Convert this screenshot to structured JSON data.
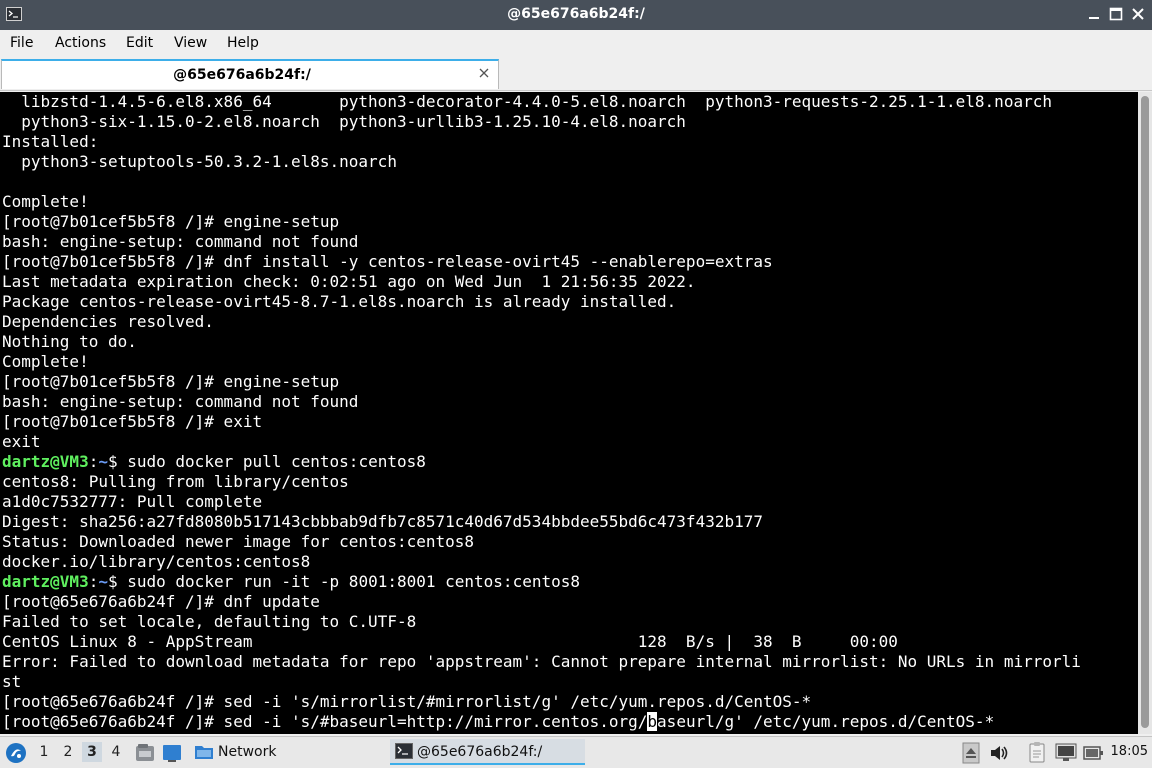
{
  "window": {
    "title": "@65e676a6b24f:/"
  },
  "menubar": {
    "items": [
      "File",
      "Actions",
      "Edit",
      "View",
      "Help"
    ]
  },
  "tab": {
    "label": "@65e676a6b24f:/"
  },
  "terminal": {
    "lines": [
      {
        "segments": [
          {
            "t": "  libzstd-1.4.5-6.el8.x86_64       python3-decorator-4.4.0-5.el8.noarch  python3-requests-2.25.1-1.el8.noarch"
          }
        ]
      },
      {
        "segments": [
          {
            "t": "  python3-six-1.15.0-2.el8.noarch  python3-urllib3-1.25.10-4.el8.noarch"
          }
        ]
      },
      {
        "segments": [
          {
            "t": "Installed:"
          }
        ]
      },
      {
        "segments": [
          {
            "t": "  python3-setuptools-50.3.2-1.el8s.noarch"
          }
        ]
      },
      {
        "segments": [
          {
            "t": ""
          }
        ]
      },
      {
        "segments": [
          {
            "t": "Complete!"
          }
        ]
      },
      {
        "segments": [
          {
            "t": "[root@7b01cef5b5f8 /]# engine-setup"
          }
        ]
      },
      {
        "segments": [
          {
            "t": "bash: engine-setup: command not found"
          }
        ]
      },
      {
        "segments": [
          {
            "t": "[root@7b01cef5b5f8 /]# dnf install -y centos-release-ovirt45 --enablerepo=extras"
          }
        ]
      },
      {
        "segments": [
          {
            "t": "Last metadata expiration check: 0:02:51 ago on Wed Jun  1 21:56:35 2022."
          }
        ]
      },
      {
        "segments": [
          {
            "t": "Package centos-release-ovirt45-8.7-1.el8s.noarch is already installed."
          }
        ]
      },
      {
        "segments": [
          {
            "t": "Dependencies resolved."
          }
        ]
      },
      {
        "segments": [
          {
            "t": "Nothing to do."
          }
        ]
      },
      {
        "segments": [
          {
            "t": "Complete!"
          }
        ]
      },
      {
        "segments": [
          {
            "t": "[root@7b01cef5b5f8 /]# engine-setup"
          }
        ]
      },
      {
        "segments": [
          {
            "t": "bash: engine-setup: command not found"
          }
        ]
      },
      {
        "segments": [
          {
            "t": "[root@7b01cef5b5f8 /]# exit"
          }
        ]
      },
      {
        "segments": [
          {
            "t": "exit"
          }
        ]
      },
      {
        "segments": [
          {
            "t": "dartz@VM3",
            "c": "u"
          },
          {
            "t": ":"
          },
          {
            "t": "~",
            "c": "p"
          },
          {
            "t": "$ sudo docker pull centos:centos8"
          }
        ]
      },
      {
        "segments": [
          {
            "t": "centos8: Pulling from library/centos"
          }
        ]
      },
      {
        "segments": [
          {
            "t": "a1d0c7532777: Pull complete"
          }
        ]
      },
      {
        "segments": [
          {
            "t": "Digest: sha256:a27fd8080b517143cbbbab9dfb7c8571c40d67d534bbdee55bd6c473f432b177"
          }
        ]
      },
      {
        "segments": [
          {
            "t": "Status: Downloaded newer image for centos:centos8"
          }
        ]
      },
      {
        "segments": [
          {
            "t": "docker.io/library/centos:centos8"
          }
        ]
      },
      {
        "segments": [
          {
            "t": "dartz@VM3",
            "c": "u"
          },
          {
            "t": ":"
          },
          {
            "t": "~",
            "c": "p"
          },
          {
            "t": "$ sudo docker run -it -p 8001:8001 centos:centos8"
          }
        ]
      },
      {
        "segments": [
          {
            "t": "[root@65e676a6b24f /]# dnf update"
          }
        ]
      },
      {
        "segments": [
          {
            "t": "Failed to set locale, defaulting to C.UTF-8"
          }
        ]
      },
      {
        "segments": [
          {
            "t": "CentOS Linux 8 - AppStream                                        128  B/s |  38  B     00:00"
          }
        ]
      },
      {
        "segments": [
          {
            "t": "Error: Failed to download metadata for repo 'appstream': Cannot prepare internal mirrorlist: No URLs in mirrorli"
          }
        ]
      },
      {
        "segments": [
          {
            "t": "st"
          }
        ]
      },
      {
        "segments": [
          {
            "t": "[root@65e676a6b24f /]# sed -i 's/mirrorlist/#mirrorlist/g' /etc/yum.repos.d/CentOS-*"
          }
        ]
      },
      {
        "segments": [
          {
            "t": "[root@65e676a6b24f /]# sed -i 's/#baseurl=http://mirror.centos.org/"
          },
          {
            "t": "b",
            "c": "cursor"
          },
          {
            "t": "aseurl/g' /etc/yum.repos.d/CentOS-*"
          }
        ]
      }
    ]
  },
  "taskbar": {
    "desktops": [
      "1",
      "2",
      "3",
      "4"
    ],
    "active_desktop": "3",
    "network_label": "Network",
    "terminal_task_label": "@65e676a6b24f:/",
    "clock": "18:05"
  },
  "colors": {
    "titlebar": "#48505a",
    "terminal_bg": "#000000",
    "user_host": "#5ff05f",
    "path": "#6b9cf5",
    "accent": "#3daee9"
  }
}
